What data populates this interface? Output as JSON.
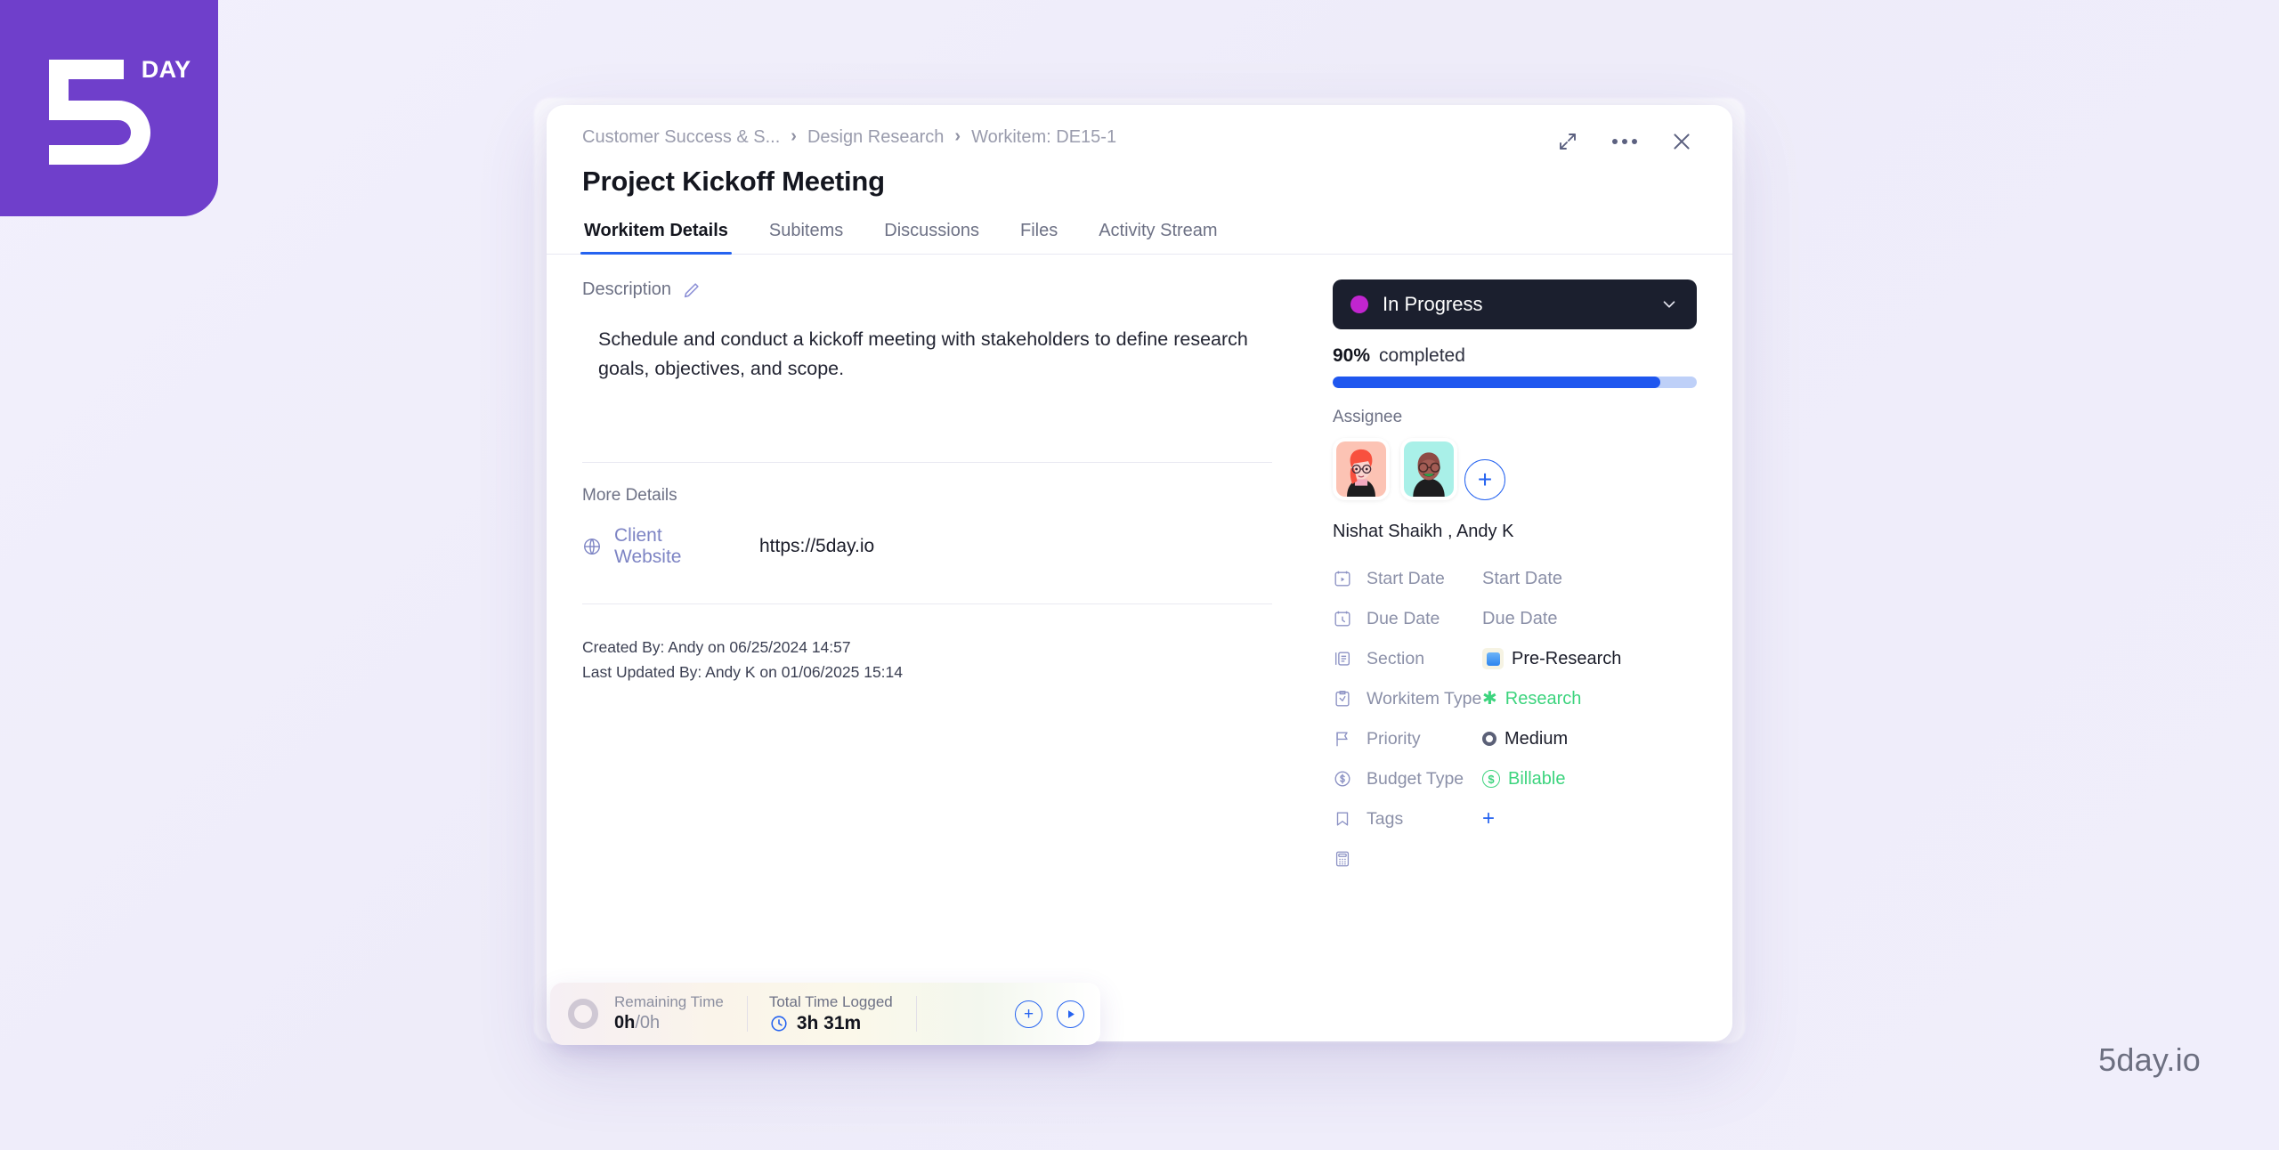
{
  "brand": {
    "mark": "5",
    "sup": "DAY"
  },
  "watermark": "5day.io",
  "modal": {
    "breadcrumb": [
      {
        "label": "Customer Success & S..."
      },
      {
        "label": "Design Research"
      },
      {
        "label": "Workitem: DE15-1"
      }
    ],
    "breadcrumb_separator": "›",
    "title": "Project Kickoff Meeting",
    "window_controls": {
      "expand": "expand-icon",
      "more": "more-options-icon",
      "close": "close-icon"
    },
    "tabs": [
      {
        "label": "Workitem Details",
        "active": true
      },
      {
        "label": "Subitems",
        "active": false
      },
      {
        "label": "Discussions",
        "active": false
      },
      {
        "label": "Files",
        "active": false
      },
      {
        "label": "Activity Stream",
        "active": false
      }
    ],
    "left": {
      "description_label": "Description",
      "edit_icon": "pencil-icon",
      "description_text": "Schedule and conduct a kickoff meeting with stakeholders to define research goals, objectives, and scope.",
      "more_details_label": "More Details",
      "client_website_label": "Client Website",
      "client_website_value": "https://5day.io",
      "created_by": "Created By: Andy on 06/25/2024 14:57",
      "last_updated_by": "Last Updated By: Andy K on 01/06/2025 15:14"
    },
    "right": {
      "status": {
        "label": "In Progress",
        "dot_color": "#c125cf",
        "bg": "#1b1f2e"
      },
      "progress": {
        "percent": "90%",
        "word": "completed",
        "value": 90,
        "bar_color": "#1f57ef",
        "track_color": "#bed0f8"
      },
      "assignee_label": "Assignee",
      "assignee_names": "Nishat Shaikh , Andy K",
      "add_assignee": "+",
      "fields": [
        {
          "icon": "start-date-icon",
          "label": "Start Date",
          "value": "Start Date",
          "style": "muted"
        },
        {
          "icon": "due-date-icon",
          "label": "Due Date",
          "value": "Due Date",
          "style": "muted"
        },
        {
          "icon": "section-icon",
          "label": "Section",
          "value": "Pre-Research",
          "style": "emoji"
        },
        {
          "icon": "workitem-type-icon",
          "label": "Workitem Type",
          "value": "Research",
          "style": "star-green"
        },
        {
          "icon": "priority-icon",
          "label": "Priority",
          "value": "Medium",
          "style": "prio"
        },
        {
          "icon": "budget-type-icon",
          "label": "Budget Type",
          "value": "Billable",
          "style": "dollar-green"
        },
        {
          "icon": "tags-icon",
          "label": "Tags",
          "value": "+",
          "style": "plus"
        }
      ],
      "calculator_icon": "calculator-icon"
    },
    "time_bar": {
      "remaining_label": "Remaining Time",
      "remaining_value": "0h",
      "remaining_total": "/0h",
      "total_label": "Total Time Logged",
      "total_value": "3h 31m",
      "add_icon": "add-time-icon",
      "play_icon": "start-timer-icon"
    }
  }
}
